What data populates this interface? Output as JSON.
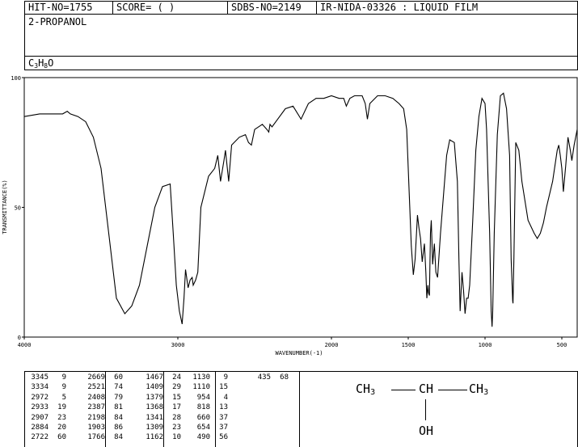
{
  "header": {
    "hit_no": "HIT-NO=1755",
    "score": "SCORE=  (   )",
    "sdbs_no": "SDBS-NO=2149",
    "ir_id": "IR-NIDA-03326 : LIQUID FILM"
  },
  "compound_name": "2-PROPANOL",
  "formula": {
    "c": "C",
    "c_n": "3",
    "h": "H",
    "h_n": "8",
    "o": "O"
  },
  "structure": {
    "ch3_left": "CH",
    "ch3_left_sub": "3",
    "ch": "CH",
    "ch3_right": "CH",
    "ch3_right_sub": "3",
    "oh": "OH"
  },
  "chart_data": {
    "type": "line",
    "xlabel": "WAVENUMBER(-1)",
    "ylabel": "TRANSMITTANCE(%)",
    "xlim": [
      4000,
      400
    ],
    "ylim": [
      0,
      100
    ],
    "x_ticks": [
      4000,
      3000,
      2000,
      1500,
      1000,
      500
    ],
    "y_ticks": [
      0,
      50,
      100
    ],
    "grid": false,
    "x": [
      4000,
      3900,
      3800,
      3750,
      3720,
      3700,
      3650,
      3600,
      3550,
      3500,
      3450,
      3400,
      3345,
      3300,
      3250,
      3200,
      3150,
      3100,
      3050,
      3030,
      3010,
      2990,
      2972,
      2960,
      2950,
      2933,
      2920,
      2907,
      2900,
      2884,
      2870,
      2850,
      2800,
      2760,
      2740,
      2722,
      2700,
      2690,
      2669,
      2650,
      2600,
      2560,
      2540,
      2521,
      2500,
      2450,
      2420,
      2408,
      2400,
      2387,
      2350,
      2300,
      2250,
      2198,
      2150,
      2100,
      2050,
      2000,
      1950,
      1920,
      1903,
      1880,
      1850,
      1800,
      1780,
      1766,
      1750,
      1700,
      1650,
      1600,
      1560,
      1530,
      1510,
      1490,
      1480,
      1467,
      1455,
      1440,
      1430,
      1420,
      1409,
      1395,
      1385,
      1379,
      1372,
      1368,
      1362,
      1355,
      1350,
      1341,
      1330,
      1320,
      1309,
      1290,
      1270,
      1250,
      1230,
      1200,
      1180,
      1170,
      1162,
      1150,
      1140,
      1130,
      1120,
      1110,
      1100,
      1080,
      1060,
      1040,
      1020,
      1000,
      990,
      970,
      960,
      954,
      950,
      940,
      920,
      900,
      880,
      860,
      840,
      830,
      820,
      818,
      812,
      800,
      780,
      760,
      720,
      680,
      660,
      640,
      620,
      600,
      560,
      530,
      520,
      510,
      500,
      490,
      475,
      460,
      445,
      435,
      420,
      400
    ],
    "y": [
      85,
      86,
      86,
      86,
      87,
      86,
      85,
      83,
      77,
      65,
      40,
      15,
      9,
      12,
      20,
      35,
      50,
      58,
      59,
      40,
      20,
      10,
      5,
      15,
      26,
      19,
      22,
      23,
      20,
      22,
      25,
      50,
      62,
      65,
      70,
      60,
      68,
      72,
      60,
      74,
      77,
      78,
      75,
      74,
      80,
      82,
      80,
      79,
      82,
      81,
      84,
      88,
      89,
      84,
      90,
      92,
      92,
      93,
      92,
      92,
      89,
      92,
      93,
      93,
      90,
      84,
      90,
      93,
      93,
      92,
      90,
      88,
      80,
      50,
      35,
      24,
      30,
      47,
      42,
      38,
      29,
      36,
      25,
      15,
      20,
      17,
      16,
      40,
      45,
      28,
      36,
      25,
      23,
      40,
      55,
      70,
      76,
      75,
      60,
      30,
      10,
      25,
      18,
      9,
      15,
      15,
      20,
      45,
      72,
      85,
      92,
      90,
      80,
      40,
      10,
      4,
      10,
      40,
      78,
      93,
      94,
      88,
      70,
      30,
      14,
      13,
      30,
      75,
      72,
      60,
      45,
      40,
      38,
      40,
      44,
      50,
      60,
      72,
      74,
      70,
      65,
      56,
      66,
      77,
      72,
      68,
      74,
      80
    ]
  },
  "peaks": [
    [
      3345,
      9
    ],
    [
      3334,
      9
    ],
    [
      2972,
      5
    ],
    [
      2933,
      19
    ],
    [
      2907,
      23
    ],
    [
      2884,
      20
    ],
    [
      2722,
      60
    ],
    [
      2669,
      60
    ],
    [
      2521,
      74
    ],
    [
      2408,
      79
    ],
    [
      2387,
      81
    ],
    [
      2198,
      84
    ],
    [
      1903,
      86
    ],
    [
      1766,
      84
    ],
    [
      1467,
      24
    ],
    [
      1409,
      29
    ],
    [
      1379,
      15
    ],
    [
      1368,
      17
    ],
    [
      1341,
      28
    ],
    [
      1309,
      23
    ],
    [
      1162,
      10
    ],
    [
      1130,
      9
    ],
    [
      1110,
      15
    ],
    [
      954,
      4
    ],
    [
      818,
      13
    ],
    [
      660,
      37
    ],
    [
      654,
      37
    ],
    [
      490,
      56
    ],
    [
      435,
      68
    ]
  ]
}
